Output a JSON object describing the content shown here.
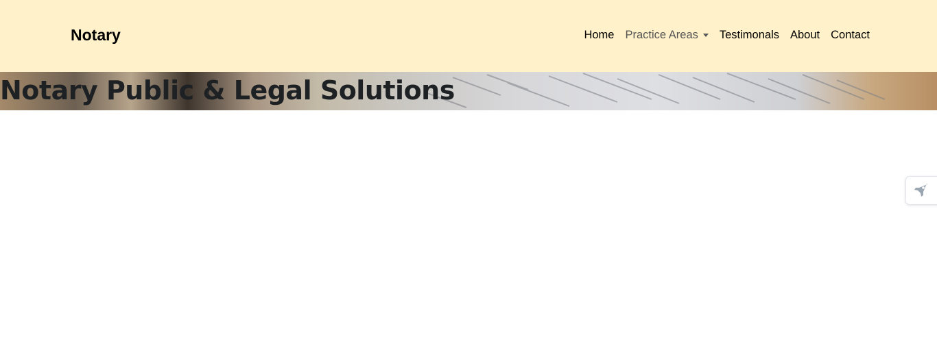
{
  "header": {
    "brand": "Notary",
    "nav": [
      {
        "label": "Home"
      },
      {
        "label": "Practice Areas",
        "has_dropdown": true
      },
      {
        "label": "Testimonals"
      },
      {
        "label": "About"
      },
      {
        "label": "Contact"
      }
    ]
  },
  "hero": {
    "title": "Notary Public & Legal Solutions"
  },
  "side_widget": {
    "icon": "rocket-icon"
  },
  "colors": {
    "navbar_bg": "#fff1c9",
    "title_text": "#1e2124",
    "muted_nav": "#555555"
  }
}
